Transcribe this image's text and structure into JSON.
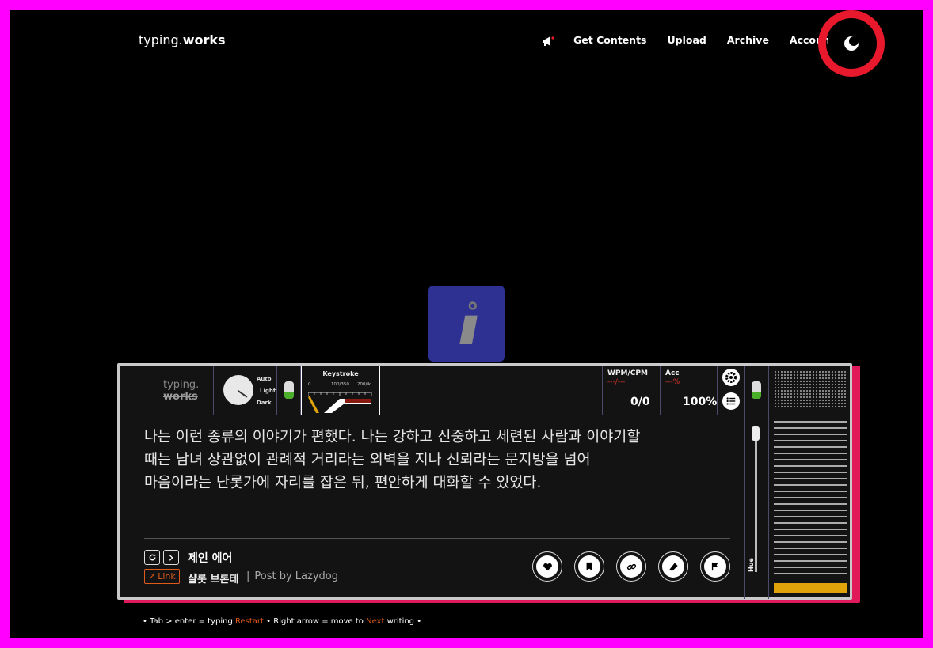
{
  "header": {
    "logo_part1": "typing.",
    "logo_part2": "works"
  },
  "nav": [
    "Get Contents",
    "Upload",
    "Archive",
    "Account"
  ],
  "machine": {
    "mini_logo_1": "typing.",
    "mini_logo_2": "works",
    "knob_labels": [
      "Auto",
      "Light",
      "Dark"
    ],
    "keystroke_title": "Keystroke",
    "keystroke_scale": [
      "0",
      "100/350",
      "200/ik"
    ],
    "wpm_label": "WPM/CPM",
    "wpm_sub": "---/---",
    "wpm_value": "0/0",
    "acc_label": "Acc",
    "acc_sub": "---%",
    "acc_value": "100%",
    "hue_label": "Hue"
  },
  "passage": {
    "lines": [
      "나는 이런 종류의 이야기가 편했다. 나는 강하고 신중하고 세련된 사람과 이야기할",
      "때는 남녀 상관없이 관례적 거리라는 외벽을 지나 신뢰라는 문지방을 넘어",
      "마음이라는 난롯가에 자리를 잡은 뒤, 편안하게 대화할 수 있었다."
    ],
    "title": "제인 에어",
    "link_label": "Link",
    "author": "샬롯 브론테",
    "separator": "|",
    "posted_by": "Post by Lazydog"
  },
  "hint": {
    "bullet": "•",
    "part1": "Tab > enter = typing",
    "restart": "Restart",
    "part2": "Right arrow = move to",
    "next": "Next",
    "part3": "writing"
  },
  "colors": {
    "frame": "#ff00ff",
    "accent_red": "#e8192c",
    "accent_orange": "#e05a1a",
    "gold": "#e0a40a",
    "info_tile": "#2e3192"
  }
}
